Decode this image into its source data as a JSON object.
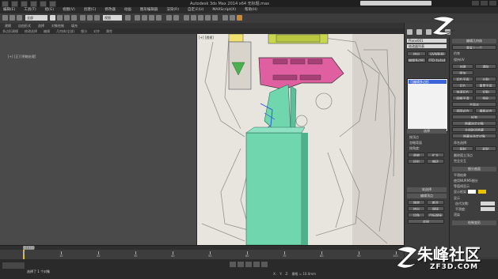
{
  "window": {
    "title": "Autodesk 3ds Max 2014 x64    无标题.max"
  },
  "menus": [
    "编辑(E)",
    "工具(T)",
    "组(G)",
    "视图(V)",
    "创建(C)",
    "修改器",
    "动画",
    "图形编辑器",
    "渲染(R)",
    "自定义(U)",
    "MAXScript(X)",
    "帮助(H)"
  ],
  "toolbar": {
    "filter": "全部",
    "view": "视图"
  },
  "ribbon": {
    "tabs": [
      "建模",
      "自由形式",
      "选择",
      "对象绘制",
      "填充"
    ],
    "subtabs": [
      "多边形建模",
      "修改选择",
      "编辑",
      "几何体(全部)",
      "细分",
      "对齐",
      "属性"
    ]
  },
  "viewports": {
    "left_label": "[+] [正] [明暗处理]",
    "main_label": "[+] [透视]"
  },
  "command_panel": {
    "name_field": "Plane001",
    "modifier_list": "修改器列表",
    "ops": [
      "挤出",
      "UVW贴图",
      "编辑多边形",
      "FFD 4x4x4"
    ],
    "stack_selected": "可编辑多边形",
    "selection_head": "选择",
    "soft_selection_head": "软选择",
    "edit_geometry_head": "编辑几何体",
    "subdiv_head": "细分曲面",
    "paint_head": "绘制变形",
    "checkbox_labels": [
      "按顶点",
      "忽略背面",
      "按角度:",
      "收缩",
      "扩大",
      "环形",
      "循环"
    ],
    "right_col": [
      "重复上一个",
      "约束",
      "保持UV",
      "创建",
      "塌陷",
      "附加",
      "切片平面",
      "分割",
      "切片",
      "重置平面",
      "快速切片",
      "切割",
      "网格平滑",
      "细化",
      "平面化",
      "视图对齐",
      "栅格对齐",
      "松弛",
      "隐藏选定对象",
      "全部取消隐藏",
      "隐藏未选定对象",
      "命名选择:",
      "复制",
      "粘贴",
      "删除孤立顶点",
      "完全交互"
    ],
    "bottom_left": [
      "编辑顶点",
      "移除",
      "断开",
      "挤出",
      "焊接",
      "切角",
      "目标焊接",
      "连接"
    ],
    "bottom_right": [
      "平滑结果",
      "使用NURMS细分",
      "等值线显示",
      "显示框架",
      "显示",
      "迭代次数:",
      "平滑度:",
      "渲染"
    ]
  },
  "timeline": {
    "frame_label": "0 / 100",
    "ruler_marks": [
      "0",
      "10",
      "20",
      "30",
      "40",
      "50",
      "60",
      "70",
      "80",
      "90",
      "100"
    ]
  },
  "status": {
    "message": "选择了 1 个对象",
    "coords": [
      "X:",
      "Y:",
      "Z:",
      "栅格 = 10.0mm"
    ]
  },
  "watermark": {
    "brand": "朱峰社区",
    "site": "ZF3D.COM"
  },
  "colors": {
    "teal": "#6fd6ae",
    "magenta": "#e05fa0",
    "olive": "#c8d84a",
    "selection_blue": "#3b64d8"
  }
}
